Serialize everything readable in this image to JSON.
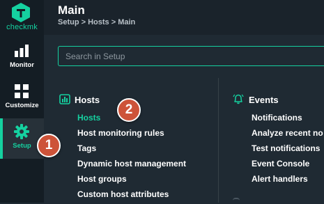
{
  "app": {
    "logo_text": "checkmk",
    "accent_color": "#15d1a0",
    "badge_color": "#cd5339"
  },
  "sidebar": {
    "items": [
      {
        "label": "Monitor",
        "icon": "bar-chart-icon",
        "active": false
      },
      {
        "label": "Customize",
        "icon": "grid-icon",
        "active": false
      },
      {
        "label": "Setup",
        "icon": "gear-icon",
        "active": true
      }
    ]
  },
  "header": {
    "title": "Main",
    "breadcrumb": "Setup > Hosts > Main"
  },
  "search": {
    "placeholder": "Search in Setup",
    "value": ""
  },
  "sections": {
    "hosts": {
      "title": "Hosts",
      "icon": "hosts-icon",
      "items": [
        "Hosts",
        "Host monitoring rules",
        "Tags",
        "Dynamic host management",
        "Host groups",
        "Custom host attributes"
      ],
      "active_index": 0
    },
    "events": {
      "title": "Events",
      "icon": "bell-icon",
      "items": [
        "Notifications",
        "Analyze recent no",
        "Test notifications",
        "Event Console",
        "Alert handlers"
      ]
    }
  },
  "callouts": {
    "badge_1": "1",
    "badge_2": "2"
  }
}
